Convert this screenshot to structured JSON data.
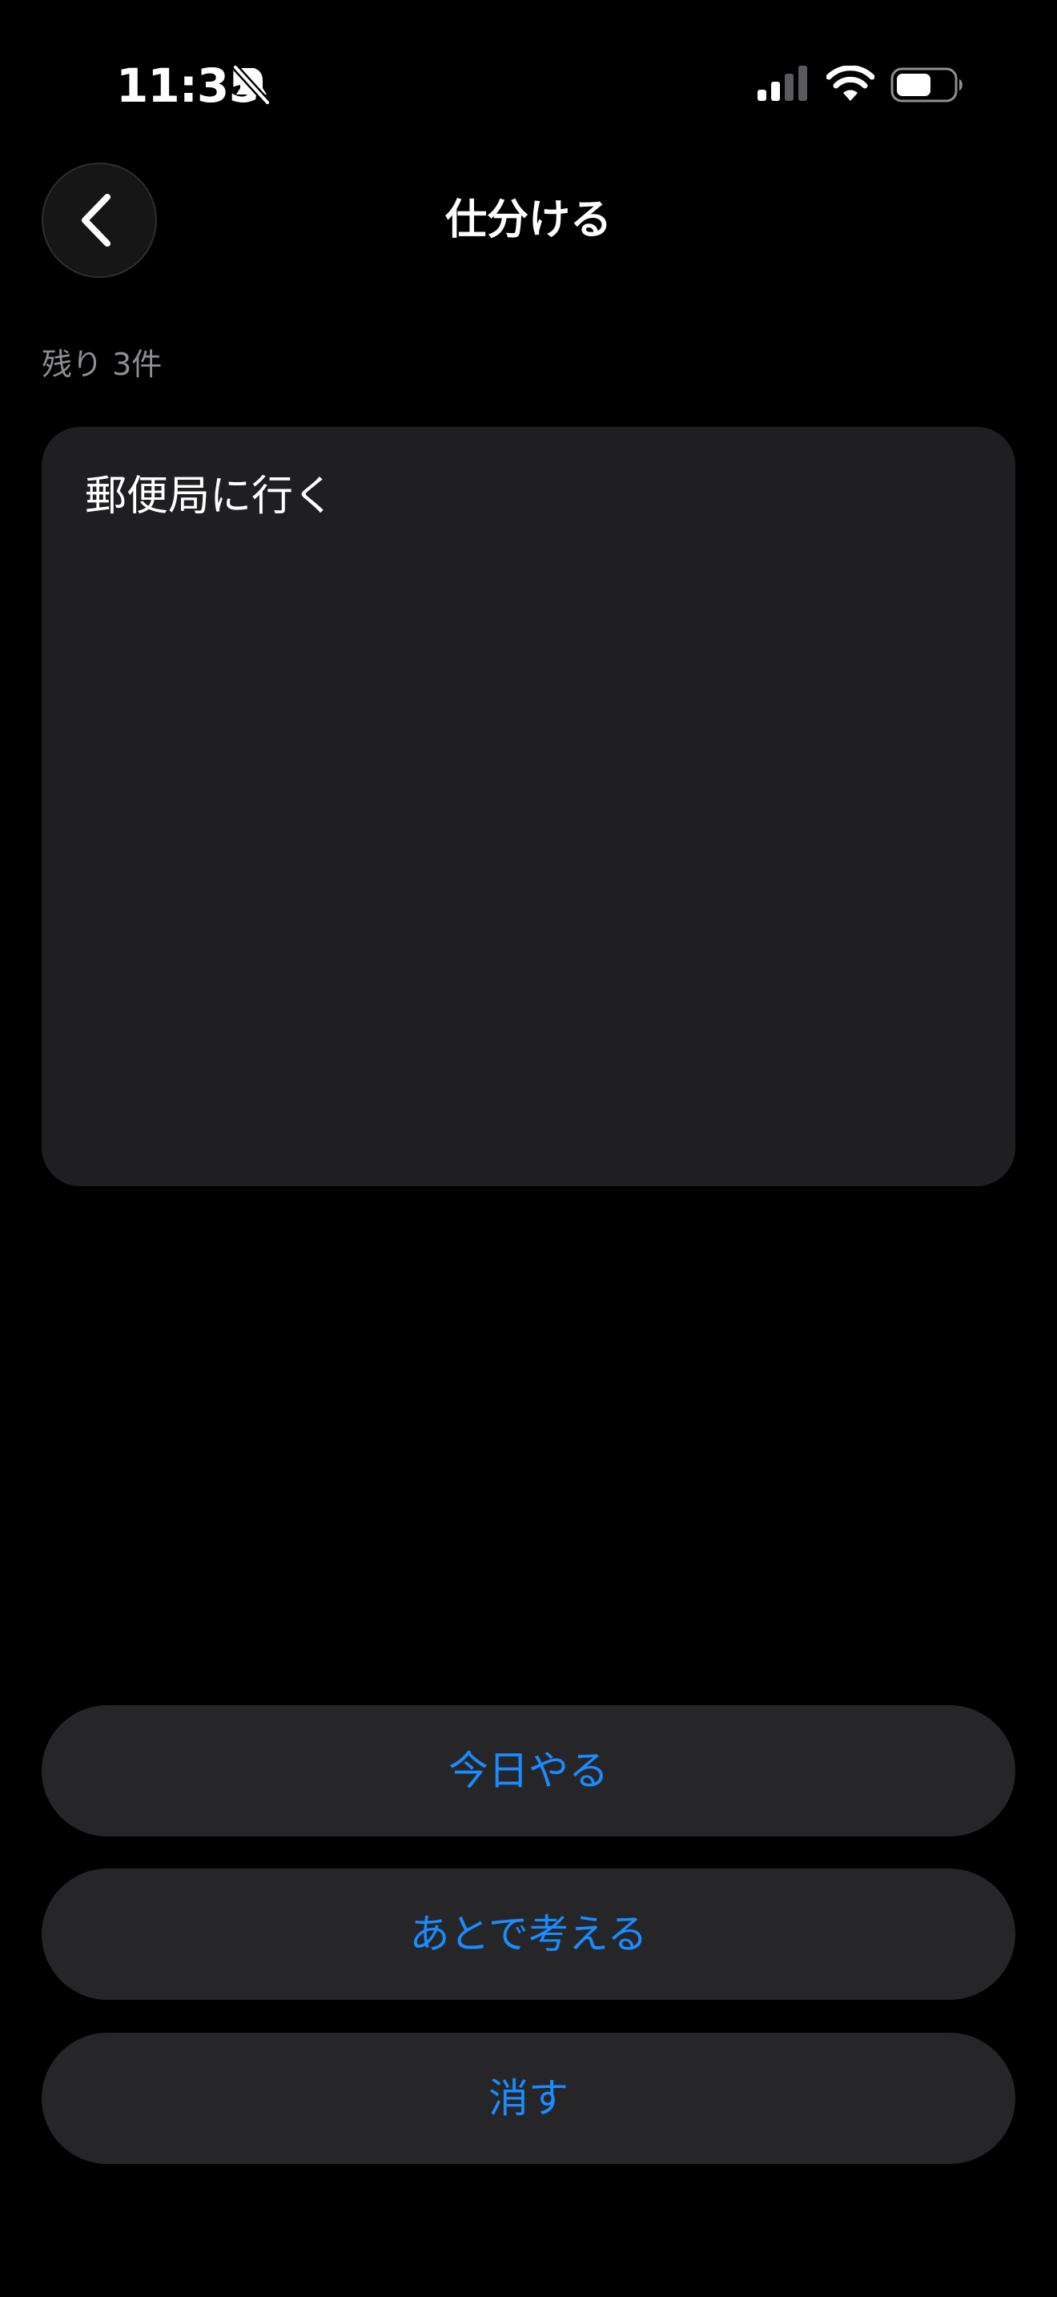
{
  "status_bar": {
    "time": "11:35",
    "icons": [
      "bell-slash-icon",
      "cellular-signal-icon",
      "wifi-icon",
      "battery-icon"
    ]
  },
  "nav": {
    "back_icon": "chevron-left-icon",
    "title": "仕分ける"
  },
  "remaining": {
    "label": "残り 3件"
  },
  "card": {
    "task_text": "郵便局に行く"
  },
  "actions": {
    "today_label": "今日やる",
    "later_label": "あとで考える",
    "delete_label": "消す"
  },
  "colors": {
    "background": "#000000",
    "card": "#1f1f21",
    "button": "#262628",
    "accent": "#1a8cff",
    "secondary_text": "#8e8e93"
  }
}
